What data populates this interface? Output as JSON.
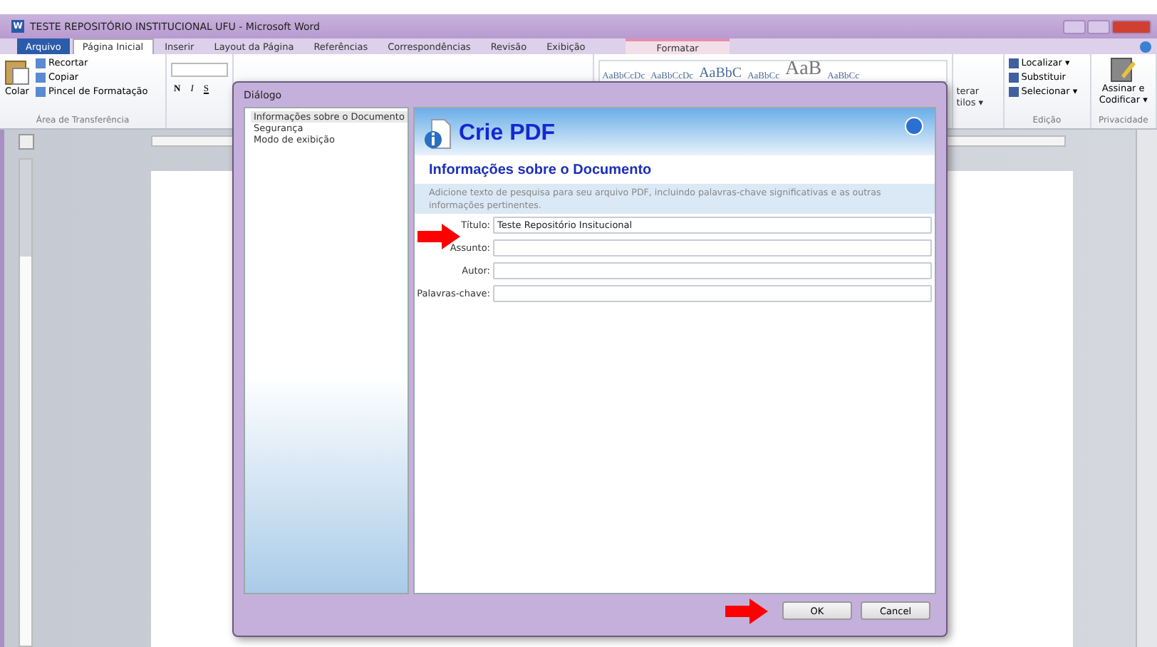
{
  "window": {
    "icon_letter": "W",
    "title": "TESTE REPOSITÓRIO INSTITUCIONAL UFU - Microsoft Word"
  },
  "tabs": [
    {
      "label": "Arquivo",
      "kind": "file",
      "selected": false
    },
    {
      "label": "Página Inicial",
      "kind": "tab",
      "selected": true
    },
    {
      "label": "Inserir",
      "kind": "tab",
      "selected": false
    },
    {
      "label": "Layout da Página",
      "kind": "tab",
      "selected": false
    },
    {
      "label": "Referências",
      "kind": "tab",
      "selected": false
    },
    {
      "label": "Correspondências",
      "kind": "tab",
      "selected": false
    },
    {
      "label": "Revisão",
      "kind": "tab",
      "selected": false
    },
    {
      "label": "Exibição",
      "kind": "tab",
      "selected": false
    },
    {
      "label": "Formatar",
      "kind": "contextual",
      "selected": false
    }
  ],
  "clipboard": {
    "paste": "Colar",
    "items": [
      "Recortar",
      "Copiar",
      "Pincel de Formatação"
    ],
    "group": "Área de Transferência"
  },
  "font": {
    "bold": "N",
    "italic": "I",
    "underline": "S"
  },
  "styles": [
    "AaBbCcDc",
    "AaBbCcDc",
    "AaBbC",
    "AaBbCc",
    "AaB",
    "AaBbCc"
  ],
  "change_styles": {
    "line_1": "terar",
    "line_2": "tilos ▾"
  },
  "editing": {
    "items": [
      "Localizar ▾",
      "Substituir",
      "Selecionar ▾"
    ],
    "group": "Edição"
  },
  "privacy": {
    "button": "Assinar e Codificar ▾",
    "group": "Privacidade"
  },
  "dialog": {
    "title": "Diálogo",
    "tree": [
      {
        "label": "Informações sobre o Documento",
        "selected": true
      },
      {
        "label": "Segurança",
        "selected": false
      },
      {
        "label": "Modo de exibição",
        "selected": false
      }
    ],
    "header": "Crie PDF",
    "section": "Informações sobre o Documento",
    "description": "Adicione texto de pesquisa para seu arquivo PDF, incluindo palavras-chave significativas  e as outras informações pertinentes.",
    "fields": [
      {
        "label": "Título:",
        "value": "Teste Repositório Insitucional"
      },
      {
        "label": "Assunto:"
      },
      {
        "label": "Autor:"
      },
      {
        "label": "Palavras-chave:"
      }
    ],
    "buttons": [
      "OK",
      "Cancel"
    ]
  }
}
